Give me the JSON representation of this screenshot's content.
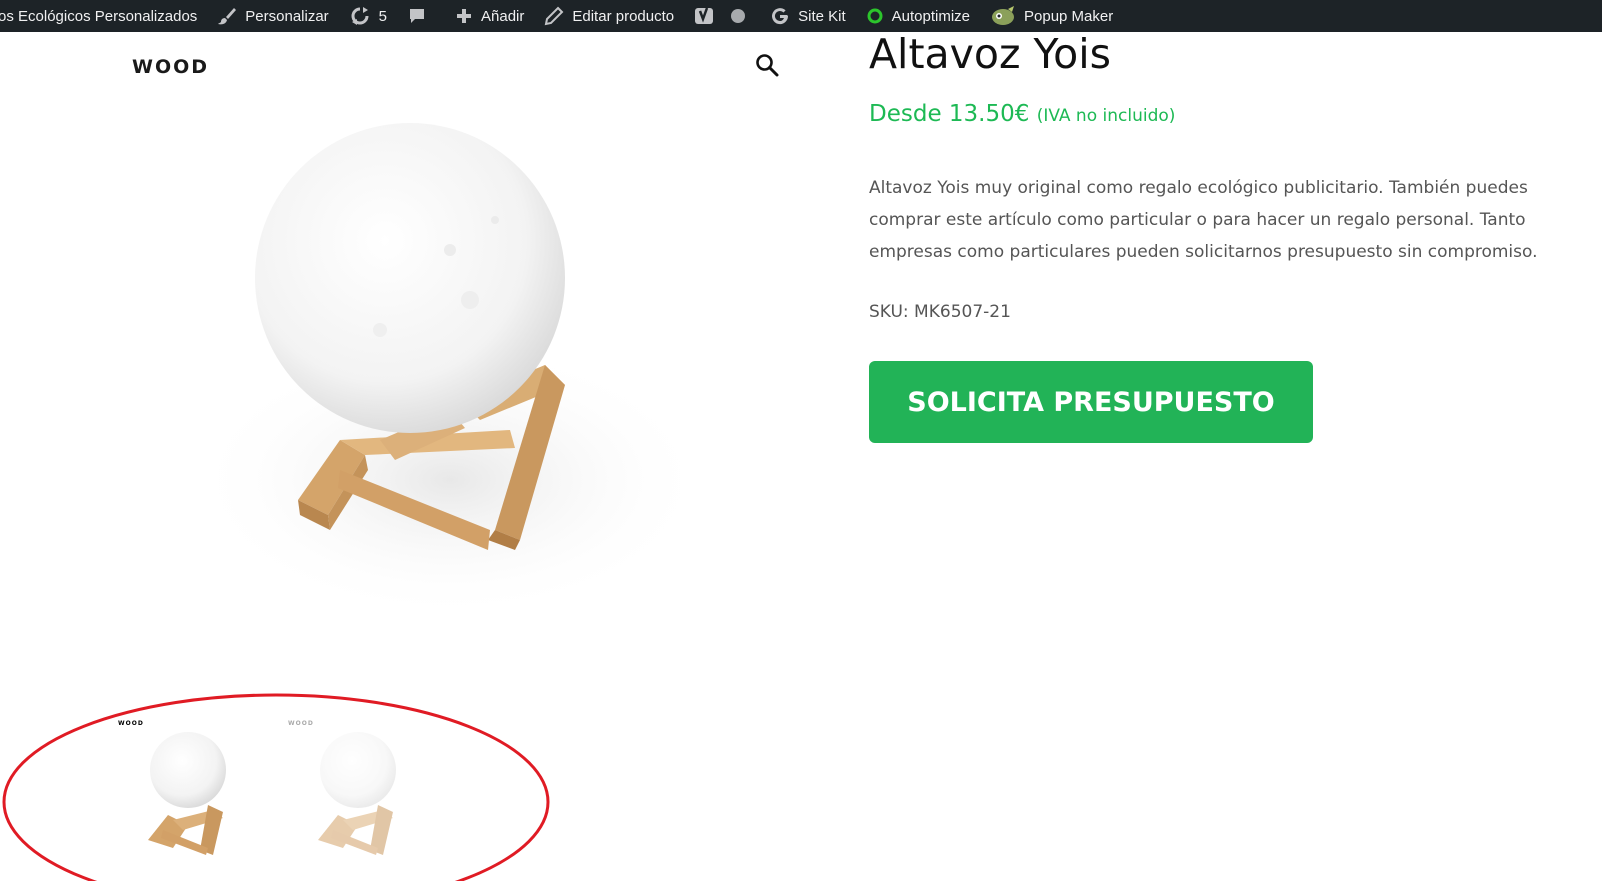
{
  "adminbar": {
    "site_name": "galos Ecológicos Personalizados",
    "customize": "Personalizar",
    "updates_count": "5",
    "add_new": "Añadir",
    "edit_product": "Editar producto",
    "site_kit": "Site Kit",
    "autoptimize": "Autoptimize",
    "popup_maker": "Popup Maker"
  },
  "gallery": {
    "brand": "WOOD",
    "thumb_brand": "WOOD"
  },
  "product": {
    "title": "Altavoz Yois",
    "price_prefix": "Desde 13.50€",
    "price_suffix": "(IVA no incluido)",
    "description": "Altavoz Yois muy original como regalo ecológico publicitario. También puedes comprar este artículo como particular o para hacer un regalo personal. Tanto empresas como particulares pueden solicitarnos presupuesto sin compromiso.",
    "sku": "SKU: MK6507-21",
    "cta": "SOLICITA PRESUPUESTO"
  },
  "colors": {
    "adminbar": "#1d2327",
    "accent_green": "#22b357",
    "price_green": "#1db954",
    "annotation_red": "#e01b24"
  },
  "icons": [
    "paintbrush-icon",
    "refresh-icon",
    "comment-icon",
    "plus-icon",
    "pencil-icon",
    "yoast-icon",
    "status-dot-icon",
    "google-icon",
    "autoptimize-ring-icon",
    "popup-maker-icon",
    "search-icon"
  ]
}
